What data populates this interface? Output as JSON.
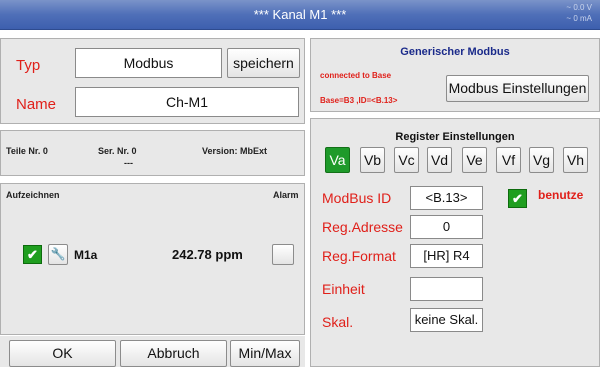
{
  "header": {
    "title": "*** Kanal M1 ***",
    "voltage": "~ 0.0 V",
    "current": "~ 0 mA"
  },
  "left": {
    "typ_label": "Typ",
    "typ_value": "Modbus",
    "save_label": "speichern",
    "name_label": "Name",
    "name_value": "Ch-M1"
  },
  "info": {
    "part_no": "Teile Nr. 0",
    "ser_no": "Ser. Nr.  0",
    "ser_no_sub": "---",
    "version": "Version: MbExt"
  },
  "recording": {
    "record_label": "Aufzeichnen",
    "alarm_label": "Alarm",
    "channel_name": "M1a",
    "value": "242.78 ppm",
    "checked": true
  },
  "footer": {
    "ok_label": "OK",
    "cancel_label": "Abbruch",
    "minmax_label": "Min/Max"
  },
  "modbus": {
    "section_title": "Generischer Modbus",
    "status_line1": "connected to Base",
    "status_line2": "Base=B3 ,ID=<B.13>",
    "settings_button": "Modbus Einstellungen"
  },
  "register": {
    "section_title": "Register Einstellungen",
    "tabs": [
      "Va",
      "Vb",
      "Vc",
      "Vd",
      "Ve",
      "Vf",
      "Vg",
      "Vh"
    ],
    "active_tab": "Va",
    "modbus_id_label": "ModBus ID",
    "modbus_id_value": "<B.13>",
    "use_label": "benutze",
    "reg_address_label": "Reg.Adresse",
    "reg_address_value": "0",
    "reg_format_label": "Reg.Format",
    "reg_format_value": "[HR] R4",
    "unit_label": "Einheit",
    "unit_value": "",
    "scale_label": "Skal.",
    "scale_value": "keine Skal."
  },
  "colors": {
    "title_bar": "#4f6fb8",
    "label_red": "#e0201a",
    "check_green": "#1f9e1f",
    "section_blue": "#1a2a8a"
  }
}
